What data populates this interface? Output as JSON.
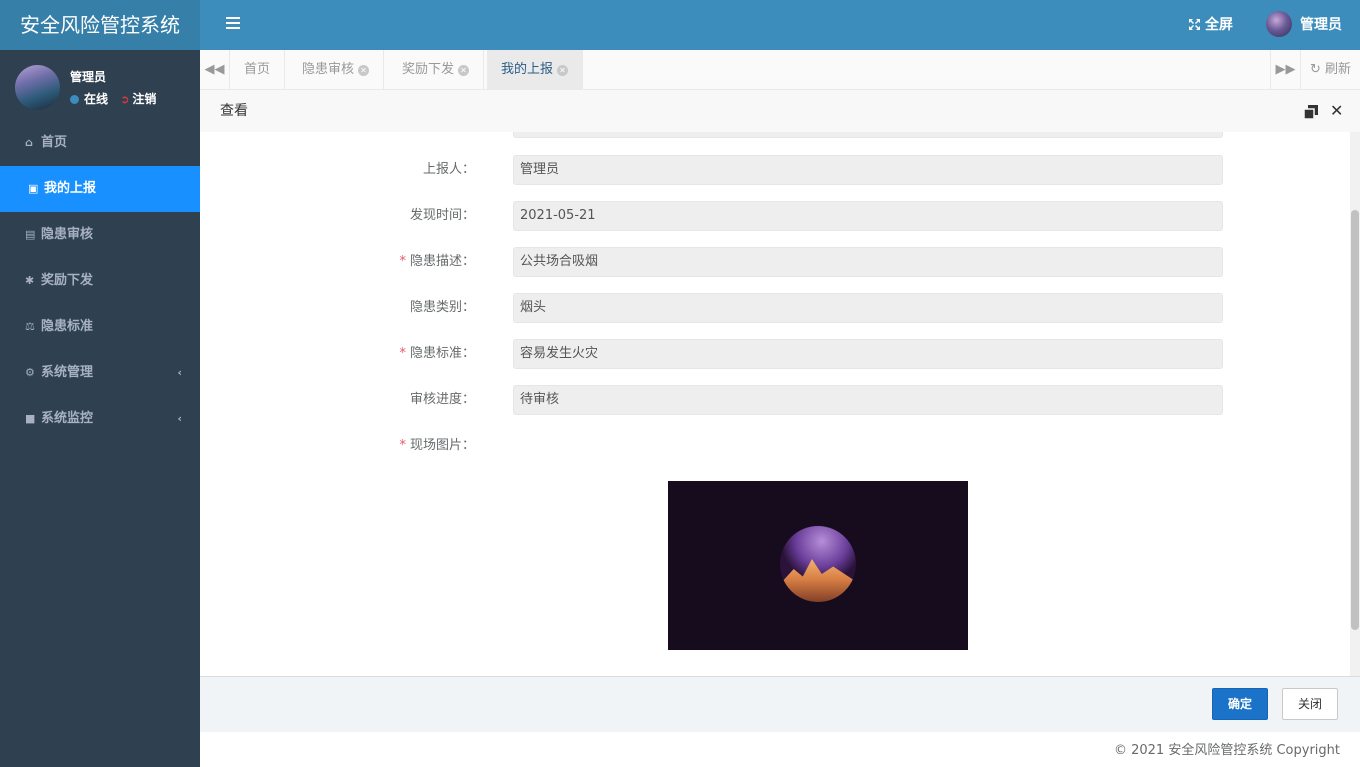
{
  "app": {
    "title": "安全风险管控系统"
  },
  "header": {
    "fullscreen_label": "全屏",
    "user_name": "管理员"
  },
  "sidebar": {
    "user": {
      "name": "管理员",
      "status": "在线",
      "logout": "注销"
    },
    "items": [
      {
        "label": "首页",
        "icon": "home-icon"
      },
      {
        "label": "我的上报",
        "icon": "user-card-icon"
      },
      {
        "label": "隐患审核",
        "icon": "id-card-icon"
      },
      {
        "label": "奖励下发",
        "icon": "asterisk-icon"
      },
      {
        "label": "隐患标准",
        "icon": "balance-scale-icon"
      },
      {
        "label": "系统管理",
        "icon": "gear-icon"
      },
      {
        "label": "系统监控",
        "icon": "video-camera-icon"
      }
    ]
  },
  "tabs": {
    "items": [
      {
        "label": "首页"
      },
      {
        "label": "隐患审核"
      },
      {
        "label": "奖励下发"
      },
      {
        "label": "我的上报"
      }
    ],
    "refresh_label": "刷新"
  },
  "modal": {
    "title": "查看",
    "fields": [
      {
        "label": "上报人：",
        "value": "管理员",
        "required": false
      },
      {
        "label": "发现时间：",
        "value": "2021-05-21",
        "required": false
      },
      {
        "label": "隐患描述：",
        "value": "公共场合吸烟",
        "required": true
      },
      {
        "label": "隐患类别：",
        "value": "烟头",
        "required": false
      },
      {
        "label": "隐患标准：",
        "value": "容易发生火灾",
        "required": true
      },
      {
        "label": "审核进度：",
        "value": "待审核",
        "required": false
      }
    ],
    "photo_label": "现场图片：",
    "required_mark": "*",
    "ok_label": "确定",
    "close_label": "关闭"
  },
  "footer": {
    "copyright": "© 2021 安全风险管控系统 Copyright"
  },
  "colors": {
    "header": "#3c8dbc",
    "logo": "#367fa9",
    "sidebar": "#2f4050",
    "active_menu": "#1890ff",
    "primary_button": "#1a73c8",
    "required": "#ed5565"
  }
}
